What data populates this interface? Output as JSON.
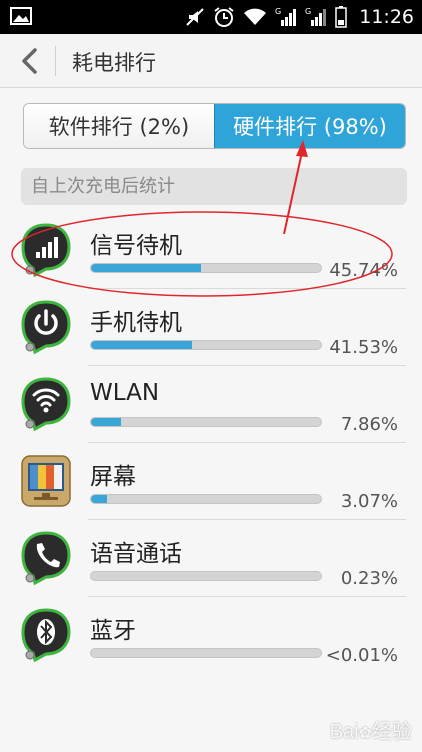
{
  "status_bar": {
    "time": "11:26",
    "icons": [
      "image-icon",
      "mute-icon",
      "alarm-icon",
      "wifi-icon",
      "signal-icon",
      "signal-icon",
      "battery-icon"
    ]
  },
  "header": {
    "title": "耗电排行"
  },
  "tabs": [
    {
      "label": "软件排行 (2%)",
      "active": false
    },
    {
      "label": "硬件排行 (98%)",
      "active": true
    }
  ],
  "section_label": "自上次充电后统计",
  "items": [
    {
      "name": "信号待机",
      "percent": "45.74%",
      "fill": 0.48,
      "icon": "signal-icon"
    },
    {
      "name": "手机待机",
      "percent": "41.53%",
      "fill": 0.44,
      "icon": "power-icon"
    },
    {
      "name": "WLAN",
      "percent": "7.86%",
      "fill": 0.13,
      "icon": "wifi-icon"
    },
    {
      "name": "屏幕",
      "percent": "3.07%",
      "fill": 0.07,
      "icon": "screen-icon"
    },
    {
      "name": "语音通话",
      "percent": "0.23%",
      "fill": 0.0,
      "icon": "phone-icon"
    },
    {
      "name": "蓝牙",
      "percent": "<0.01%",
      "fill": 0.0,
      "icon": "bluetooth-icon"
    }
  ],
  "colors": {
    "accent": "#2ea4d8",
    "annotation": "#e0262b"
  }
}
